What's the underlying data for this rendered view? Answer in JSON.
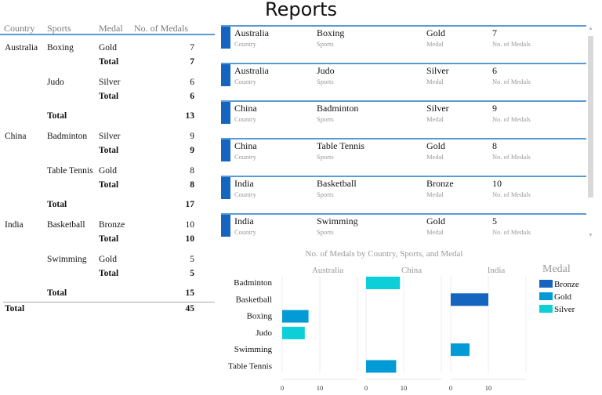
{
  "title": "Reports",
  "matrix": {
    "headers": [
      "Country",
      "Sports",
      "Medal",
      "No. of Medals"
    ],
    "rows": [
      {
        "country": "Australia",
        "sport": "Boxing",
        "medal": "Gold",
        "value": "7",
        "y": 0
      },
      {
        "medal": "Total",
        "value": "7",
        "bold": true
      },
      {
        "sport": "Judo",
        "medal": "Silver",
        "value": "6"
      },
      {
        "medal": "Total",
        "value": "6",
        "bold": true
      },
      {
        "sport": "Total",
        "value": "13",
        "bold": true,
        "subtotal": true
      },
      {
        "country": "China",
        "sport": "Badminton",
        "medal": "Silver",
        "value": "9"
      },
      {
        "medal": "Total",
        "value": "9",
        "bold": true
      },
      {
        "sport": "Table Tennis",
        "medal": "Gold",
        "value": "8"
      },
      {
        "medal": "Total",
        "value": "8",
        "bold": true
      },
      {
        "sport": "Total",
        "value": "17",
        "bold": true,
        "subtotal": true
      },
      {
        "country": "India",
        "sport": "Basketball",
        "medal": "Bronze",
        "value": "10"
      },
      {
        "medal": "Total",
        "value": "10",
        "bold": true
      },
      {
        "sport": "Swimming",
        "medal": "Gold",
        "value": "5"
      },
      {
        "medal": "Total",
        "value": "5",
        "bold": true
      },
      {
        "sport": "Total",
        "value": "15",
        "bold": true,
        "subtotal": true
      }
    ],
    "grand_total_label": "Total",
    "grand_total_value": "45"
  },
  "cards": {
    "labels": {
      "country": "Country",
      "sport": "Sports",
      "medal": "Medal",
      "value": "No. of Medals"
    },
    "items": [
      {
        "country": "Australia",
        "sport": "Boxing",
        "medal": "Gold",
        "value": "7"
      },
      {
        "country": "Australia",
        "sport": "Judo",
        "medal": "Silver",
        "value": "6"
      },
      {
        "country": "China",
        "sport": "Badminton",
        "medal": "Silver",
        "value": "9"
      },
      {
        "country": "China",
        "sport": "Table Tennis",
        "medal": "Gold",
        "value": "8"
      },
      {
        "country": "India",
        "sport": "Basketball",
        "medal": "Bronze",
        "value": "10"
      },
      {
        "country": "India",
        "sport": "Swimming",
        "medal": "Gold",
        "value": "5"
      }
    ]
  },
  "colors": {
    "Bronze": "#1565c0",
    "Gold": "#039bd5",
    "Silver": "#0ccfd8",
    "accent": "#5b9bd5"
  },
  "chart_data": {
    "type": "bar",
    "title": "No. of Medals by Country, Sports, and Medal",
    "orientation": "horizontal",
    "facets": [
      "Australia",
      "China",
      "India"
    ],
    "categories": [
      "Badminton",
      "Basketball",
      "Boxing",
      "Judo",
      "Swimming",
      "Table Tennis"
    ],
    "xticks": [
      "0",
      "10"
    ],
    "xlim": [
      0,
      20
    ],
    "legend_title": "Medal",
    "legend": [
      "Bronze",
      "Gold",
      "Silver"
    ],
    "legend_position": "right",
    "bars": [
      {
        "facet": "Australia",
        "category": "Boxing",
        "medal": "Gold",
        "value": 7
      },
      {
        "facet": "Australia",
        "category": "Judo",
        "medal": "Silver",
        "value": 6
      },
      {
        "facet": "China",
        "category": "Badminton",
        "medal": "Silver",
        "value": 9
      },
      {
        "facet": "China",
        "category": "Table Tennis",
        "medal": "Gold",
        "value": 8
      },
      {
        "facet": "India",
        "category": "Basketball",
        "medal": "Bronze",
        "value": 10
      },
      {
        "facet": "India",
        "category": "Swimming",
        "medal": "Gold",
        "value": 5
      }
    ]
  }
}
